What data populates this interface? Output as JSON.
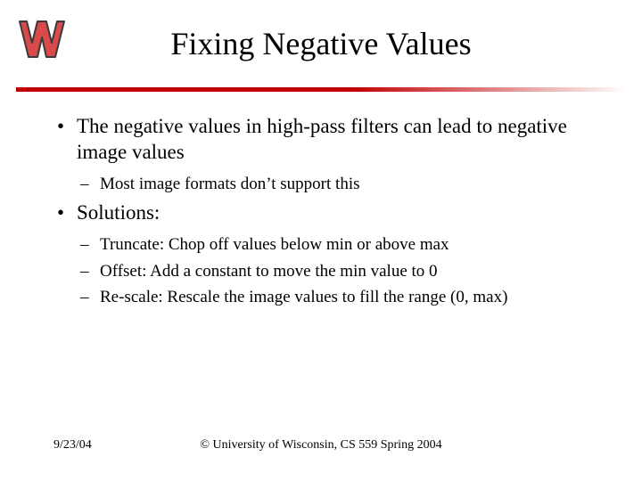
{
  "title": "Fixing Negative Values",
  "logo_alt": "Wisconsin W logo",
  "bullets": [
    {
      "text": "The negative values in high-pass filters can lead to negative image values",
      "sub": [
        "Most image formats don’t support this"
      ]
    },
    {
      "text": "Solutions:",
      "sub": [
        "Truncate: Chop off values below min or above max",
        "Offset: Add a constant to move the min value to 0",
        "Re-scale: Rescale the image values to fill the range (0, max)"
      ]
    }
  ],
  "footer": {
    "date": "9/23/04",
    "copyright": "© University of Wisconsin, CS 559 Spring 2004"
  }
}
